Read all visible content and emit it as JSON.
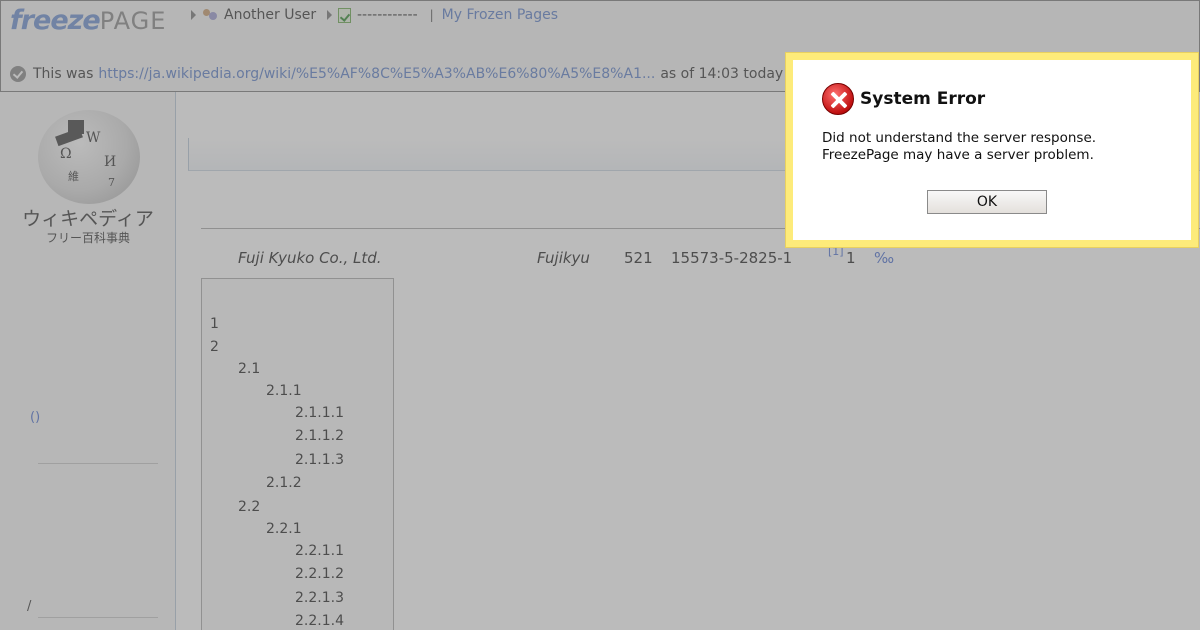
{
  "header": {
    "logo_freeze": "freeze",
    "logo_page": "PAGE",
    "user_label": "Another User",
    "dashes": "------------",
    "separator": "|",
    "my_frozen_pages": "My Frozen Pages",
    "this_was": "This was",
    "url": "https://ja.wikipedia.org/wiki/%E5%AF%8C%E5%A3%AB%E6%80%A5%E8%A1...",
    "as_of": "as of 14:03 today"
  },
  "sidebar": {
    "title": "ウィキペディア",
    "subtitle": "フリー百科事典",
    "paren": "()",
    "slash": "/"
  },
  "article": {
    "company_en": "Fuji Kyuko Co., Ltd.",
    "short_name": "Fujikyu",
    "num1": "521",
    "code": "15573-5-2825-1",
    "ref": "[1]",
    "num2": "1",
    "permille": "‰"
  },
  "toc": [
    {
      "num": "1",
      "level": 0
    },
    {
      "num": "2",
      "level": 0
    },
    {
      "num": "2.1",
      "level": 1
    },
    {
      "num": "2.1.1",
      "level": 2
    },
    {
      "num": "2.1.1.1",
      "level": 3
    },
    {
      "num": "2.1.1.2",
      "level": 3
    },
    {
      "num": "2.1.1.3",
      "level": 3
    },
    {
      "num": "2.1.2",
      "level": 2
    },
    {
      "num": "2.2",
      "level": 1
    },
    {
      "num": "2.2.1",
      "level": 2
    },
    {
      "num": "2.2.1.1",
      "level": 3
    },
    {
      "num": "2.2.1.2",
      "level": 3
    },
    {
      "num": "2.2.1.3",
      "level": 3
    },
    {
      "num": "2.2.1.4",
      "level": 3
    }
  ],
  "dialog": {
    "title": "System Error",
    "line1": "Did not understand the server response.",
    "line2": "FreezePage may have a server problem.",
    "ok_label": "OK",
    "icon": "error-icon"
  },
  "colors": {
    "dialog_border": "#fdeb7a",
    "link": "#5a7ec8",
    "error_red": "#c01010"
  }
}
